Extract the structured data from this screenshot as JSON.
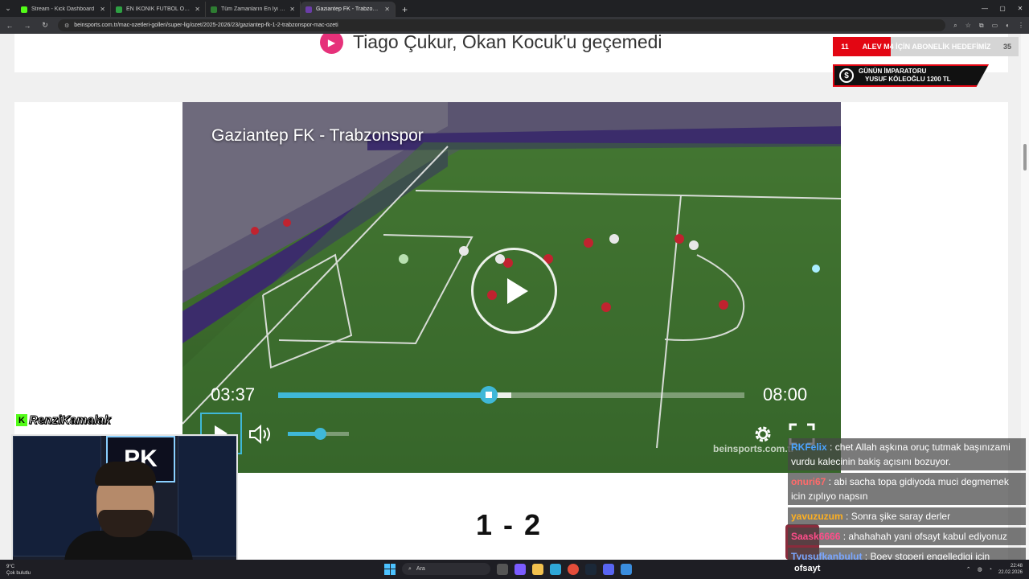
{
  "browser": {
    "tabs": [
      {
        "title": "Stream - Kick Dashboard",
        "color": "#53fc18",
        "active": false
      },
      {
        "title": "EN İKONİK FUTBOL OLAYLARI",
        "color": "#2ea043",
        "active": false
      },
      {
        "title": "Tüm Zamanların En İyi Golü - T",
        "color": "#2e7d32",
        "active": false
      },
      {
        "title": "Gaziantep FK - Trabzonspor Ma",
        "color": "#6a3da8",
        "active": true
      }
    ],
    "url": "beinsports.com.tr/mac-ozetleri-golleri/super-lig/ozet/2025-2026/23/gaziantep-fk-1-2-trabzonspor-mac-ozeti"
  },
  "page": {
    "headline": "Tiago Çukur, Okan Kocuk'u geçemedi",
    "score": "1-2"
  },
  "video": {
    "title": "Gaziantep FK - Trabzonspor",
    "current_time": "03:37",
    "duration": "08:00",
    "progress_fraction": 0.452,
    "buffered_fraction": 0.5,
    "volume_fraction": 0.53,
    "watermark": "beinsports.com.tr"
  },
  "overlay": {
    "goal_left": "11",
    "goal_text": "ALEV M4 İÇİN ABONELİK HEDEFİMİZ",
    "goal_right": "35",
    "goal_fraction": 0.31,
    "emperor_line1": "GÜNÜN İMPARATORU",
    "emperor_line2": "YUSUF KÖLEOĞLU 1200 TL",
    "streamer": "RenziKamalak",
    "chat_title": "ofsayt"
  },
  "chat": [
    {
      "user": "RKFelix",
      "color": "#4aa3ff",
      "text": "chet Allah aşkına oruç tutmak başınızami vurdu kalecinin bakiş açısını bozuyor."
    },
    {
      "user": "onuri67",
      "color": "#ff6a6a",
      "text": "abi sacha topa gidiyoda muci degmemek icin zıplıyo napsın"
    },
    {
      "user": "yavuzuzum",
      "color": "#ffb020",
      "text": "Sonra şike saray derler"
    },
    {
      "user": "Saask6666",
      "color": "#ff4d8a",
      "text": "ahahahah yani ofsayt kabul ediyonuz"
    },
    {
      "user": "Tyusufkanbulut",
      "color": "#7aa7ff",
      "text": "Boey stoperi engelledigi için"
    }
  ],
  "taskbar": {
    "weather_temp": "9°C",
    "weather_desc": "Çok bulutlu",
    "search": "Ara",
    "time": "22:48",
    "date": "22.02.2026"
  }
}
